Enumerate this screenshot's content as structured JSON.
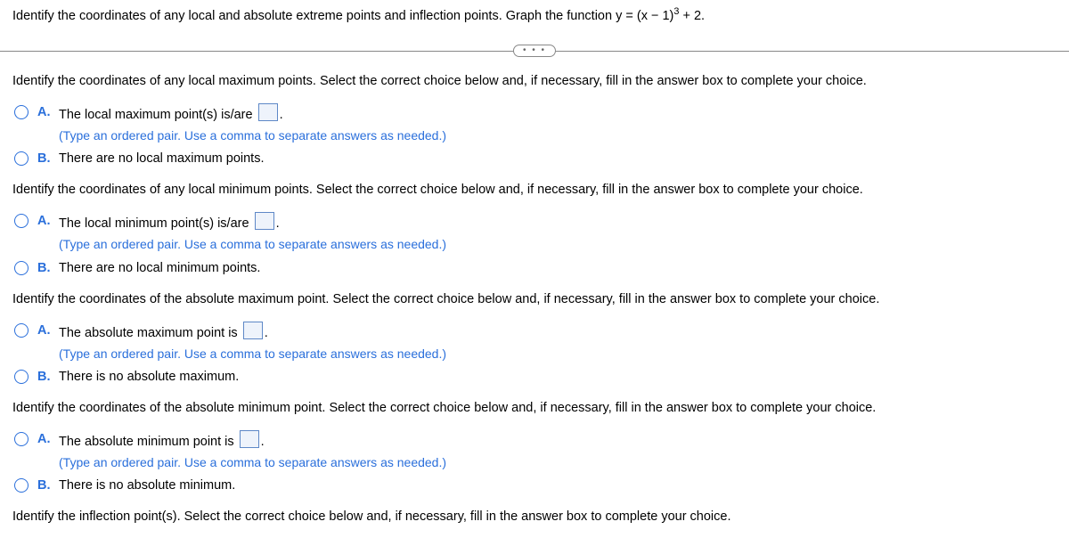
{
  "question": {
    "prefix": "Identify the coordinates of any local and absolute extreme points and inflection points. Graph the function y = (x − 1)",
    "exp": "3",
    "suffix": " + 2."
  },
  "pill": "• • •",
  "sections": [
    {
      "prompt": "Identify the coordinates of any local maximum points. Select the correct choice below and, if necessary, fill in the answer box to complete your choice.",
      "optA_pre": "The local maximum point(s) is/are ",
      "optA_post": ".",
      "hint": "(Type an ordered pair. Use a comma to separate answers as needed.)",
      "optB": "There are no local maximum points."
    },
    {
      "prompt": "Identify the coordinates of any local minimum points. Select the correct choice below and, if necessary, fill in the answer box to complete your choice.",
      "optA_pre": "The local minimum point(s) is/are ",
      "optA_post": ".",
      "hint": "(Type an ordered pair. Use a comma to separate answers as needed.)",
      "optB": "There are no local minimum points."
    },
    {
      "prompt": "Identify the coordinates of the absolute maximum point. Select the correct choice below and, if necessary, fill in the answer box to complete your choice.",
      "optA_pre": "The absolute maximum point is ",
      "optA_post": ".",
      "hint": "(Type an ordered pair. Use a comma to separate answers as needed.)",
      "optB": "There is no absolute maximum."
    },
    {
      "prompt": "Identify the coordinates of the absolute minimum point. Select the correct choice below and, if necessary, fill in the answer box to complete your choice.",
      "optA_pre": "The absolute minimum point is ",
      "optA_post": ".",
      "hint": "(Type an ordered pair. Use a comma to separate answers as needed.)",
      "optB": "There is no absolute minimum."
    }
  ],
  "inflection_prompt": "Identify the inflection point(s). Select the correct choice below and, if necessary, fill in the answer box to complete your choice.",
  "letters": {
    "A": "A.",
    "B": "B."
  }
}
